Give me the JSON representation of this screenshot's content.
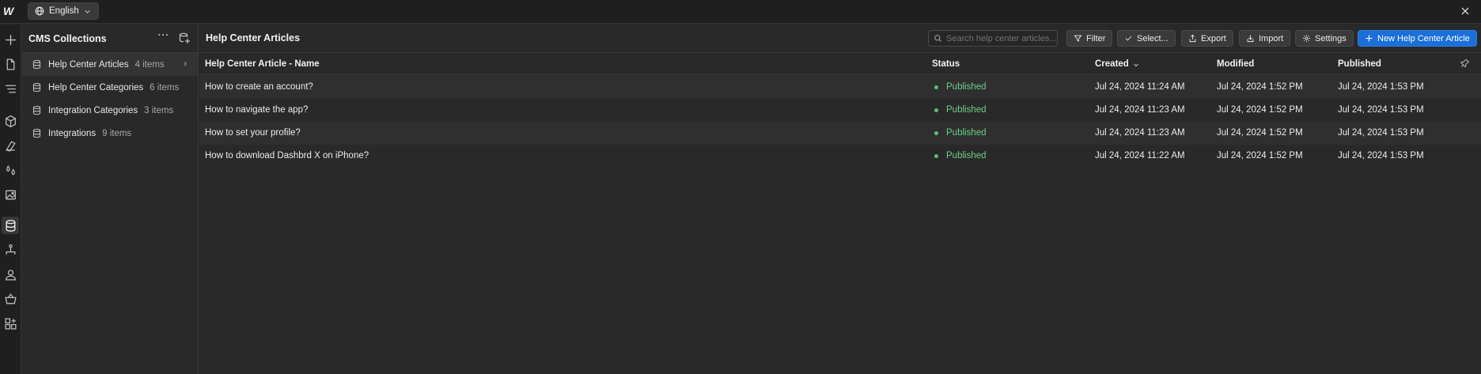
{
  "topbar": {
    "logo": "W",
    "language": "English",
    "close_icon": "close-icon"
  },
  "rail": {
    "icons": [
      "add-icon",
      "page-icon",
      "navigator-icon",
      "components-icon",
      "styles-icon",
      "variables-icon",
      "assets-icon",
      "cms-icon",
      "logic-icon",
      "users-icon",
      "ecommerce-icon",
      "apps-icon"
    ]
  },
  "panel": {
    "title": "CMS Collections",
    "more_icon": "more-icon",
    "collections": [
      {
        "name": "Help Center Articles",
        "count": "4 items",
        "active": true
      },
      {
        "name": "Help Center Categories",
        "count": "6 items",
        "active": false
      },
      {
        "name": "Integration Categories",
        "count": "3 items",
        "active": false
      },
      {
        "name": "Integrations",
        "count": "9 items",
        "active": false
      }
    ]
  },
  "main": {
    "title": "Help Center Articles",
    "search_placeholder": "Search help center articles...",
    "buttons": {
      "filter": "Filter",
      "select": "Select...",
      "export": "Export",
      "import": "Import",
      "settings": "Settings",
      "new": "New Help Center Article"
    },
    "columns": {
      "name": "Help Center Article - Name",
      "status": "Status",
      "created": "Created",
      "modified": "Modified",
      "published": "Published"
    },
    "rows": [
      {
        "name": "How to create an account?",
        "status": "Published",
        "created": "Jul 24, 2024 11:24 AM",
        "modified": "Jul 24, 2024 1:52 PM",
        "published": "Jul 24, 2024 1:53 PM"
      },
      {
        "name": "How to navigate the app?",
        "status": "Published",
        "created": "Jul 24, 2024 11:23 AM",
        "modified": "Jul 24, 2024 1:52 PM",
        "published": "Jul 24, 2024 1:53 PM"
      },
      {
        "name": "How to set your profile?",
        "status": "Published",
        "created": "Jul 24, 2024 11:23 AM",
        "modified": "Jul 24, 2024 1:52 PM",
        "published": "Jul 24, 2024 1:53 PM"
      },
      {
        "name": "How to download Dashbrd X on iPhone?",
        "status": "Published",
        "created": "Jul 24, 2024 11:22 AM",
        "modified": "Jul 24, 2024 1:52 PM",
        "published": "Jul 24, 2024 1:53 PM"
      }
    ]
  },
  "colors": {
    "accent": "#1a6fd8",
    "published": "#6bcf8a"
  }
}
